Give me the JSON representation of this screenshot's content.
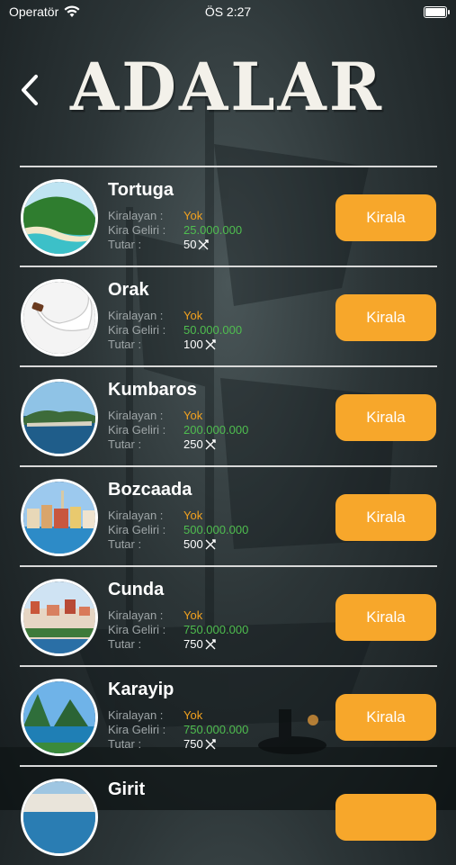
{
  "status": {
    "carrier": "Operatör",
    "time": "ÖS 2:27"
  },
  "header": {
    "title": "ADALAR"
  },
  "labels": {
    "renter": "Kiralayan :",
    "income": "Kira Geliri :",
    "amount": "Tutar :"
  },
  "islands": [
    {
      "name": "Tortuga",
      "renter": "Yok",
      "income": "25.000.000",
      "amount": "50",
      "button": "Kirala"
    },
    {
      "name": "Orak",
      "renter": "Yok",
      "income": "50.000.000",
      "amount": "100",
      "button": "Kirala"
    },
    {
      "name": "Kumbaros",
      "renter": "Yok",
      "income": "200.000.000",
      "amount": "250",
      "button": "Kirala"
    },
    {
      "name": "Bozcaada",
      "renter": "Yok",
      "income": "500.000.000",
      "amount": "500",
      "button": "Kirala"
    },
    {
      "name": "Cunda",
      "renter": "Yok",
      "income": "750.000.000",
      "amount": "750",
      "button": "Kirala"
    },
    {
      "name": "Karayip",
      "renter": "Yok",
      "income": "750.000.000",
      "amount": "750",
      "button": "Kirala"
    },
    {
      "name": "Girit",
      "renter": "",
      "income": "",
      "amount": "",
      "button": ""
    }
  ],
  "colors": {
    "accent": "#f7a72b",
    "renter": "#f3a21f",
    "income": "#4fbe4f"
  }
}
